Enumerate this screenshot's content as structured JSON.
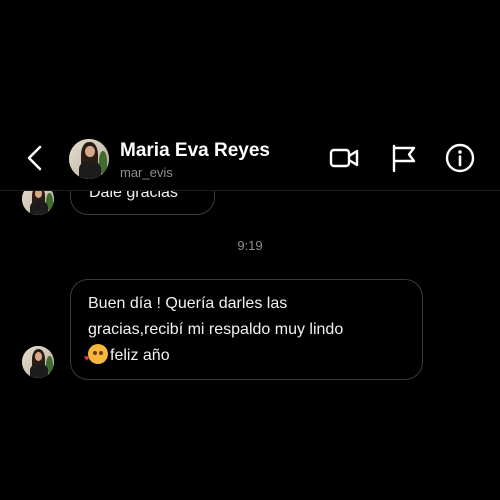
{
  "header": {
    "name": "Maria Eva Reyes",
    "username": "mar_evis",
    "icons": {
      "back": "chevron-left-icon",
      "video": "video-call-icon",
      "flag": "flag-icon",
      "info": "info-icon"
    }
  },
  "messages": {
    "previous_text": "Dale gracias",
    "timestamp": "9:19",
    "main_lines": [
      "Buen día ! Quería darles las",
      "gracias,recibí mi respaldo muy lindo",
      "feliz año"
    ],
    "emoji": "smiling-face-with-hearts-emoji"
  },
  "colors": {
    "background": "#000000",
    "bubble_border": "#3a3a3c",
    "secondary_text": "#8e8e93"
  }
}
